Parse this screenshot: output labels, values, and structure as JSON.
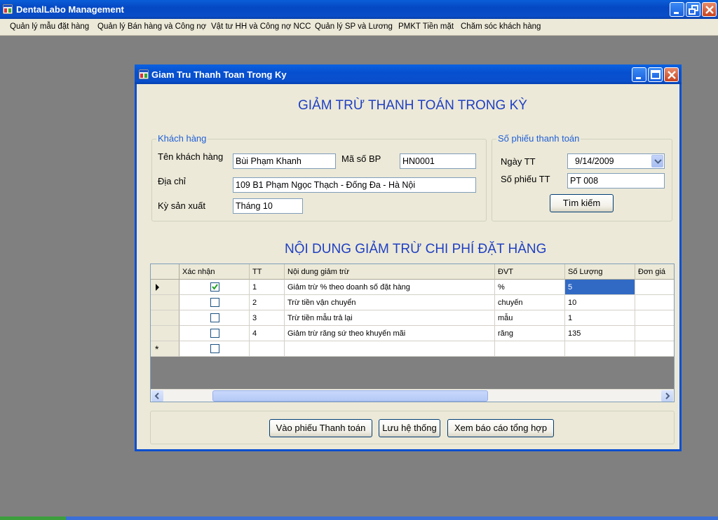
{
  "window": {
    "title": "DentalLabo Management"
  },
  "menu": [
    "Quản lý mẫu đặt hàng",
    "Quản lý Bán hàng và Công nợ",
    "Vật tư HH và Công nợ NCC",
    "Quản lý SP và Lương",
    "PMKT Tiền mặt",
    "Chăm sóc khách hàng"
  ],
  "child": {
    "title": "Giam Tru Thanh Toan Trong Ky",
    "heading": "GIẢM TRỪ THANH TOÁN TRONG KỲ",
    "customer_group": {
      "legend": "Khách hàng",
      "name_label": "Tên khách hàng",
      "name_value": "Bùi Phạm Khanh",
      "code_label": "Mã số BP",
      "code_value": "HN0001",
      "address_label": "Địa chỉ",
      "address_value": "109 B1 Phạm Ngọc Thạch - Đống Đa - Hà Nội",
      "period_label": "Kỳ sản xuất",
      "period_value": "Tháng 10"
    },
    "payment_group": {
      "legend": "Số phiếu thanh toán",
      "date_label": "Ngày TT",
      "date_value": "9/14/2009",
      "number_label": "Số phiếu TT",
      "number_value": "PT 008",
      "search_button": "Tìm kiếm"
    },
    "grid_heading": "NỘI DUNG GIẢM TRỪ CHI PHÍ ĐẶT HÀNG",
    "grid": {
      "columns": [
        "Xác nhận",
        "TT",
        "Nội dung giảm trừ",
        "ĐVT",
        "Số Lượng",
        "Đơn giá"
      ],
      "rows": [
        {
          "checked": true,
          "tt": "1",
          "content": "Giảm trừ % theo doanh số đặt hàng",
          "unit": "%",
          "qty": "5",
          "price": ""
        },
        {
          "checked": false,
          "tt": "2",
          "content": "Trừ tiền vận chuyển",
          "unit": "chuyến",
          "qty": "10",
          "price": ""
        },
        {
          "checked": false,
          "tt": "3",
          "content": "Trừ tiền mẫu trả lại",
          "unit": "mẫu",
          "qty": "1",
          "price": ""
        },
        {
          "checked": false,
          "tt": "4",
          "content": "Giảm trừ răng sứ theo khuyến mãi",
          "unit": "răng",
          "qty": "135",
          "price": ""
        }
      ],
      "new_row_marker": "*"
    },
    "buttons": {
      "enter_payment": "Vào phiếu Thanh toán",
      "save": "Lưu hệ thống",
      "report": "Xem báo cáo tổng hợp"
    }
  }
}
